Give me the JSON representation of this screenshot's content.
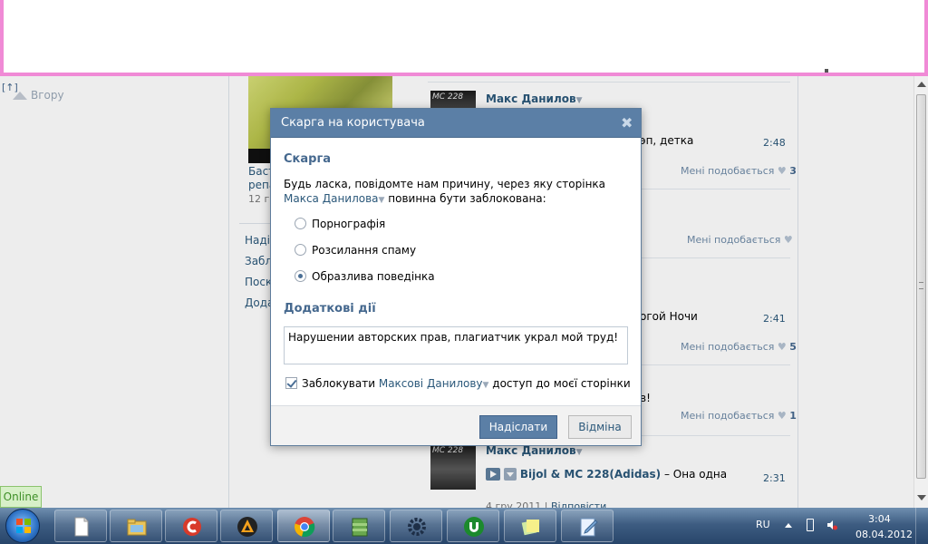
{
  "page": {
    "up_link": "[↑]",
    "back_label": "Вгору",
    "left_lines": [
      "Баст",
      "репа",
      "12 гр"
    ],
    "left_menu": [
      "Надіс",
      "Забл",
      "Поск",
      "Дода"
    ],
    "online_label": "Online"
  },
  "feed": {
    "thumb_tag": "MC 228",
    "author": "Макс Данилов",
    "dropdown_glyph": "▼",
    "item1_text": "эп, детка",
    "item1_time": "2:48",
    "item1_like_label": "Мені подобається",
    "item1_like_count": "3",
    "item2_like_label": "Мені подобається",
    "item3_text": "огой Ночи",
    "item3_time": "2:41",
    "item3_like_label": "Мені подобається",
    "item3_like_count": "5",
    "item4_text": "в!",
    "item4_like_label": "Мені подобається",
    "item4_like_count": "1",
    "item5_author": "Макс Данилов",
    "item5_track_artist": "Bijol & MC 228(Adidas)",
    "item5_track_title": " – Она одна",
    "item5_time": "2:31",
    "item5_date": "4 гру 2011 | ",
    "item5_reply": "Відповісти"
  },
  "dialog": {
    "title": "Скарга на користувача",
    "close_glyph": "✖",
    "section1_title": "Скарга",
    "prompt_before": "Будь ласка, повідомте нам причину, через яку сторінка ",
    "prompt_link": "Макса Данилова",
    "prompt_after": " повинна бути заблокована:",
    "options": [
      {
        "label": "Порнографія",
        "selected": false
      },
      {
        "label": "Розсилання спаму",
        "selected": false
      },
      {
        "label": "Образлива поведінка",
        "selected": true
      }
    ],
    "section2_title": "Додаткові дії",
    "comment_value": "Нарушении авторских прав, плагиатчик украл мой труд!",
    "block_before": "Заблокувати ",
    "block_link": "Максові Данилову",
    "block_after": " доступ до моєї сторінки",
    "block_checked": true,
    "send_label": "Надіслати",
    "cancel_label": "Відміна"
  },
  "taskbar": {
    "language": "RU",
    "time": "3:04",
    "date": "08.04.2012",
    "apps": [
      "notepad",
      "file-explorer",
      "ccleaner",
      "aimp",
      "chrome",
      "winrar",
      "settings",
      "utorrent",
      "sticky-notes",
      "notebook"
    ]
  },
  "colors": {
    "accent": "#5b7fa6",
    "link": "#2b587a",
    "border_pink": "#f08ad6"
  }
}
